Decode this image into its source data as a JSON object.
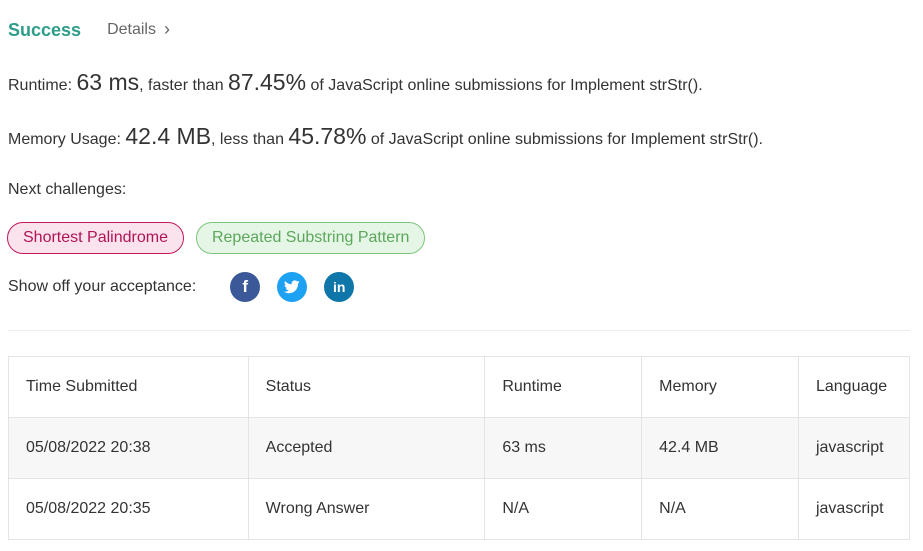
{
  "header": {
    "status": "Success",
    "details_label": "Details"
  },
  "runtime": {
    "label": "Runtime: ",
    "value": "63 ms",
    "mid": ", faster than ",
    "percent": "87.45%",
    "suffix": " of JavaScript online submissions for Implement strStr()."
  },
  "memory": {
    "label": "Memory Usage: ",
    "value": "42.4 MB",
    "mid": ", less than ",
    "percent": "45.78%",
    "suffix": " of JavaScript online submissions for Implement strStr()."
  },
  "next": {
    "label": "Next challenges:",
    "challenges": [
      {
        "title": "Shortest Palindrome",
        "difficulty_color": "#c2185b"
      },
      {
        "title": "Repeated Substring Pattern",
        "difficulty_color": "#5ca75c"
      }
    ]
  },
  "share": {
    "label": "Show off your acceptance:",
    "icons": [
      "facebook-icon",
      "twitter-icon",
      "linkedin-icon"
    ]
  },
  "table": {
    "headers": [
      "Time Submitted",
      "Status",
      "Runtime",
      "Memory",
      "Language"
    ],
    "rows": [
      {
        "time": "05/08/2022 20:38",
        "status": "Accepted",
        "runtime": "63 ms",
        "memory": "42.4 MB",
        "language": "javascript"
      },
      {
        "time": "05/08/2022 20:35",
        "status": "Wrong Answer",
        "runtime": "N/A",
        "memory": "N/A",
        "language": "javascript"
      }
    ]
  },
  "colors": {
    "success": "#2d9d8a",
    "wrong": "#c0392b",
    "hard": "#c2185b",
    "easy": "#5ca75c"
  }
}
